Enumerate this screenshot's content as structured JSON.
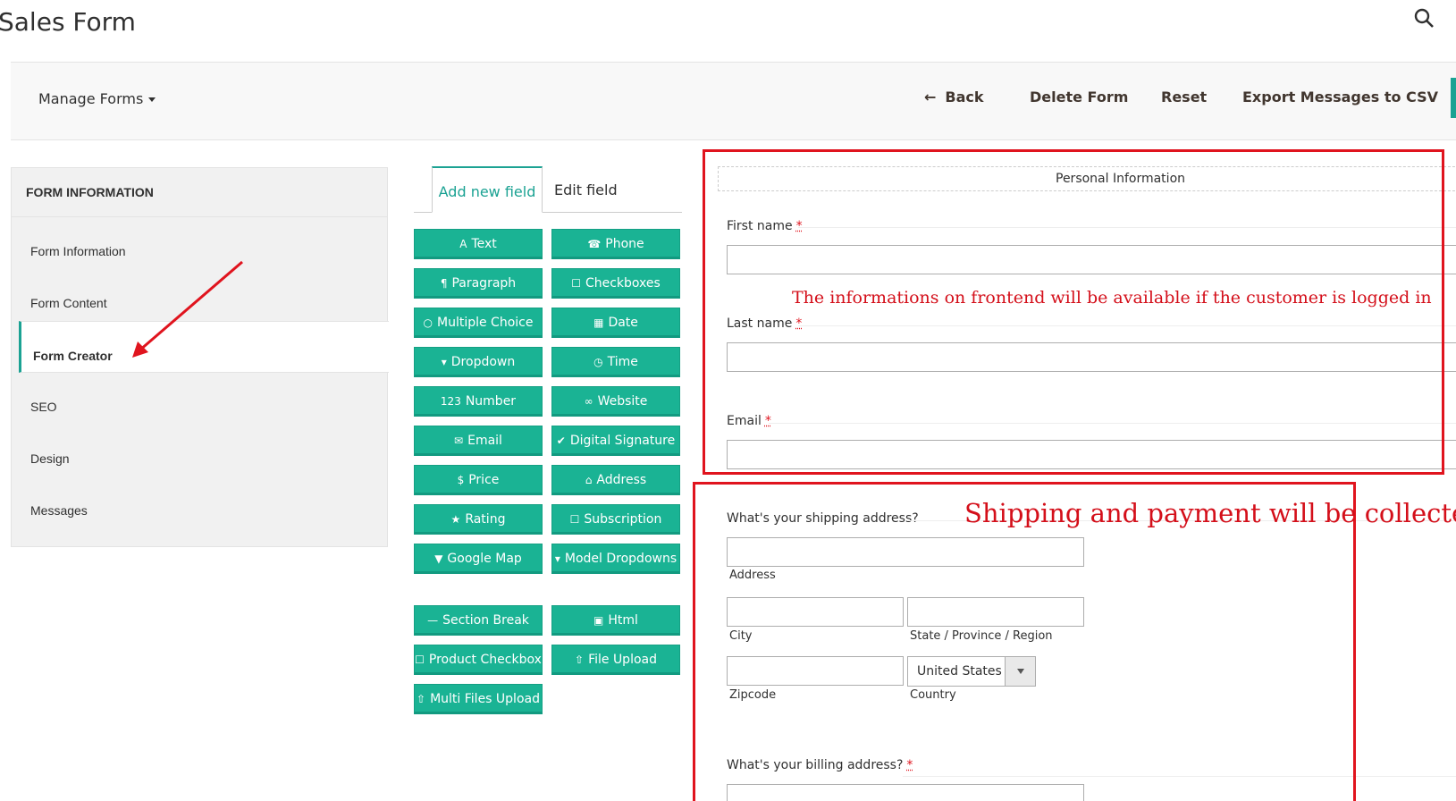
{
  "page": {
    "title": "Sales Form"
  },
  "toolbar": {
    "manage_forms": "Manage Forms",
    "back": "Back",
    "delete": "Delete Form",
    "reset": "Reset",
    "export": "Export Messages to CSV",
    "accent": "#1ba293"
  },
  "sidebar": {
    "heading": "FORM INFORMATION",
    "items": [
      {
        "label": "Form Information"
      },
      {
        "label": "Form Content"
      },
      {
        "label": "Form Creator",
        "active": true
      },
      {
        "label": "SEO"
      },
      {
        "label": "Design"
      },
      {
        "label": "Messages"
      }
    ]
  },
  "tabs": {
    "add": "Add new field",
    "edit": "Edit field"
  },
  "field_buttons": [
    {
      "label": "Text",
      "icon": "text-icon"
    },
    {
      "label": "Phone",
      "icon": "phone-icon"
    },
    {
      "label": "Paragraph",
      "icon": "paragraph-icon"
    },
    {
      "label": "Checkboxes",
      "icon": "checkbox-icon"
    },
    {
      "label": "Multiple Choice",
      "icon": "radio-icon"
    },
    {
      "label": "Date",
      "icon": "calendar-icon"
    },
    {
      "label": "Dropdown",
      "icon": "caret-down-icon"
    },
    {
      "label": "Time",
      "icon": "clock-icon"
    },
    {
      "label": "Number",
      "icon": "number-icon"
    },
    {
      "label": "Website",
      "icon": "link-icon"
    },
    {
      "label": "Email",
      "icon": "envelope-icon"
    },
    {
      "label": "Digital Signature",
      "icon": "check-icon"
    },
    {
      "label": "Price",
      "icon": "dollar-icon"
    },
    {
      "label": "Address",
      "icon": "home-icon"
    },
    {
      "label": "Rating",
      "icon": "star-icon"
    },
    {
      "label": "Subscription",
      "icon": "checkbox-icon"
    },
    {
      "label": "Google Map",
      "icon": "map-marker-icon"
    },
    {
      "label": "Model Dropdowns",
      "icon": "caret-down-icon"
    },
    {
      "label": "Section Break",
      "icon": "minus-icon"
    },
    {
      "label": "Html",
      "icon": "html-icon"
    },
    {
      "label": "Product Checkbox",
      "icon": "checkbox-icon"
    },
    {
      "label": "File Upload",
      "icon": "upload-icon"
    },
    {
      "label": "Multi Files Upload",
      "icon": "upload-icon"
    }
  ],
  "form": {
    "section_title": "Personal Information",
    "first_name": "First name",
    "last_name": "Last name",
    "email": "Email",
    "required_mark": "*",
    "shipping_question": "What's your shipping address?",
    "address_label": "Address",
    "city_label": "City",
    "state_label": "State / Province / Region",
    "zip_label": "Zipcode",
    "country_label": "Country",
    "country_value": "United States",
    "billing_question": "What's your billing address?"
  },
  "annotations": {
    "note1": "The informations on frontend will be available if the customer is logged in",
    "note2": "Shipping and payment will be collected",
    "color": "#e0141e"
  }
}
